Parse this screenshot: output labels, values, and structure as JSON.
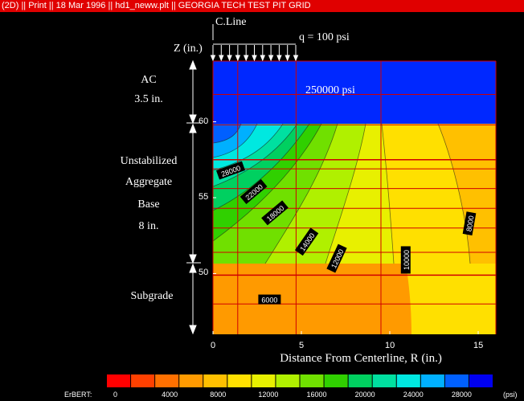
{
  "titlebar": {
    "text": "(2D) || Print || 18 Mar 1996 || hd1_neww.plt || GEORGIA TECH TEST PIT GRID"
  },
  "annotations": {
    "centerline": "C.Line",
    "load": "q = 100 psi",
    "z_label": "Z (in.)",
    "ac_modulus": "250000 psi"
  },
  "layers": [
    {
      "name": "AC",
      "thickness": "3.5 in."
    },
    {
      "lines": [
        "Unstabilized",
        "Aggregate",
        "Base",
        "8 in."
      ]
    },
    {
      "name": "Subgrade"
    }
  ],
  "colors": {
    "background": "#000000",
    "title_bar": "#e00000",
    "ac_layer": "#0028ff",
    "grid": "#d00000",
    "scale": [
      "#ff0000",
      "#ff4000",
      "#ff7000",
      "#ff9a00",
      "#ffc000",
      "#ffe000",
      "#e8f000",
      "#b0f000",
      "#70e000",
      "#30d000",
      "#00d060",
      "#00e0a0",
      "#00e8e0",
      "#00b0ff",
      "#0060ff",
      "#0000f0"
    ]
  },
  "chart_data": {
    "type": "heatmap",
    "title": "",
    "xlabel": "Distance From Centerline, R (in.)",
    "ylabel": "Z (in.)",
    "xlim": [
      0,
      16
    ],
    "ylim": [
      46,
      64
    ],
    "x_ticks": [
      0,
      5,
      10,
      15
    ],
    "y_ticks": [
      50,
      55,
      60
    ],
    "grid": true,
    "layer_boundaries": [
      57.5,
      49.9
    ],
    "grid_lines_x": [
      1.4,
      4.7,
      9.5
    ],
    "grid_lines_y": [
      61.8,
      59.8,
      56.9,
      55.6,
      54.3,
      53.0,
      51.4,
      48.0
    ],
    "contour_labels": [
      {
        "text": "28000",
        "x": 1.0,
        "y": 56.8
      },
      {
        "text": "22000",
        "x": 2.3,
        "y": 55.4
      },
      {
        "text": "18000",
        "x": 3.5,
        "y": 54.0
      },
      {
        "text": "14000",
        "x": 5.3,
        "y": 52.1
      },
      {
        "text": "12000",
        "x": 7.0,
        "y": 51.0
      },
      {
        "text": "10000",
        "x": 10.9,
        "y": 50.9
      },
      {
        "text": "8000",
        "x": 14.5,
        "y": 53.3
      },
      {
        "text": "6000",
        "x": 3.2,
        "y": 48.3
      }
    ],
    "legend": {
      "label": "ErBERT:",
      "unit": "(psi)",
      "range": [
        0,
        32000
      ],
      "tick_values": [
        0,
        4000,
        8000,
        12000,
        16000,
        20000,
        24000,
        28000
      ]
    }
  }
}
